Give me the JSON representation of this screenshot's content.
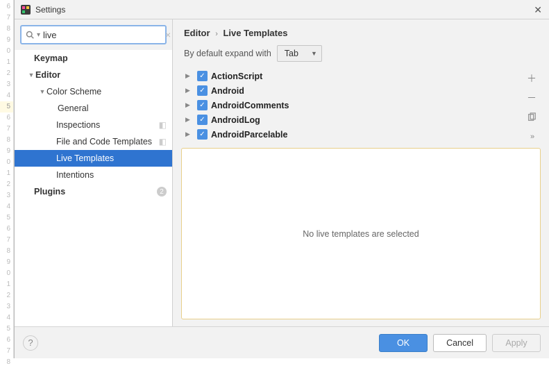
{
  "gutter_lines": [
    "6",
    "7",
    "8",
    "9",
    "0",
    "1",
    "2",
    "3",
    "4",
    "5",
    "6",
    "7",
    "8",
    "9",
    "0",
    "1",
    "2",
    "3",
    "4",
    "5",
    "6",
    "7",
    "8",
    "9",
    "0",
    "1",
    "2",
    "3",
    "4",
    "5",
    "6",
    "7",
    "8"
  ],
  "gutter_highlight_index": 9,
  "title": "Settings",
  "search": {
    "value": "live",
    "placeholder": ""
  },
  "tree": {
    "keymap": "Keymap",
    "editor": "Editor",
    "color_scheme": "Color Scheme",
    "general": "General",
    "inspections": "Inspections",
    "file_templates": "File and Code Templates",
    "live_templates": "Live Templates",
    "intentions": "Intentions",
    "plugins": "Plugins",
    "plugins_badge": "2"
  },
  "breadcrumb": {
    "a": "Editor",
    "b": "Live Templates"
  },
  "expand": {
    "label": "By default expand with",
    "value": "Tab"
  },
  "groups": [
    {
      "name": "ActionScript"
    },
    {
      "name": "Android"
    },
    {
      "name": "AndroidComments"
    },
    {
      "name": "AndroidLog"
    },
    {
      "name": "AndroidParcelable"
    }
  ],
  "preview_msg": "No live templates are selected",
  "buttons": {
    "ok": "OK",
    "cancel": "Cancel",
    "apply": "Apply"
  }
}
